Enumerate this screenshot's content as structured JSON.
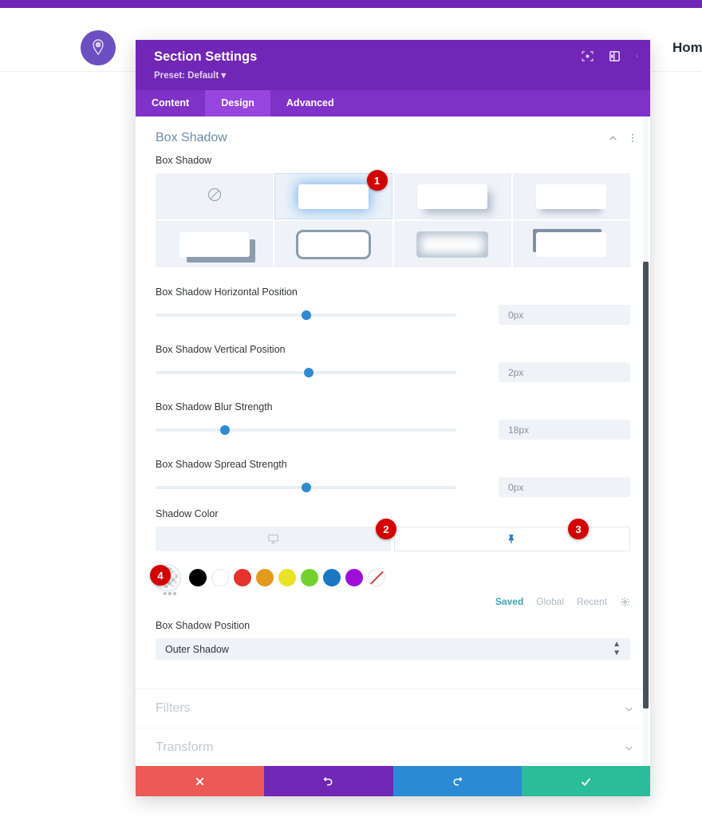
{
  "site": {
    "logo_icon": "map-pin-icon",
    "nav_home": "Home",
    "brand_color": "#7027b5"
  },
  "modal": {
    "title": "Section Settings",
    "preset_label": "Preset: Default",
    "header_icons": [
      "focus-icon",
      "layout-panel-icon",
      "more-vertical-icon"
    ],
    "tabs": [
      {
        "label": "Content",
        "active": false
      },
      {
        "label": "Design",
        "active": true
      },
      {
        "label": "Advanced",
        "active": false
      }
    ],
    "section": {
      "title": "Box Shadow",
      "caret_icon": "chevron-up-icon",
      "menu_icon": "more-vertical-icon"
    },
    "box_shadow": {
      "label": "Box Shadow",
      "presets": [
        {
          "name": "none",
          "style": "p-none",
          "selected": false,
          "badge": null
        },
        {
          "name": "glow",
          "style": "p1",
          "selected": true,
          "badge": "1"
        },
        {
          "name": "diagonal-soft",
          "style": "p2",
          "selected": false,
          "badge": null
        },
        {
          "name": "bottom-soft",
          "style": "p3",
          "selected": false,
          "badge": null
        },
        {
          "name": "hard-diagonal",
          "style": "p4",
          "selected": false,
          "badge": null
        },
        {
          "name": "outline-thick",
          "style": "p5",
          "selected": false,
          "badge": null
        },
        {
          "name": "inner-glow",
          "style": "p6",
          "selected": false,
          "badge": null
        },
        {
          "name": "top-left-hard",
          "style": "p7",
          "selected": false,
          "badge": null
        }
      ]
    },
    "sliders": [
      {
        "label": "Box Shadow Horizontal Position",
        "value": "0px",
        "percent": 50
      },
      {
        "label": "Box Shadow Vertical Position",
        "value": "2px",
        "percent": 51
      },
      {
        "label": "Box Shadow Blur Strength",
        "value": "18px",
        "percent": 23
      },
      {
        "label": "Box Shadow Spread Strength",
        "value": "0px",
        "percent": 50
      }
    ],
    "shadow_color": {
      "label": "Shadow Color",
      "tabs": [
        {
          "name": "desktop-responsive-tab",
          "icon": "monitor-icon",
          "active": true,
          "badge": "2"
        },
        {
          "name": "pin-hover-tab",
          "icon": "pin-icon",
          "active": false,
          "badge": "3"
        }
      ],
      "selected_swatch": {
        "name": "transparent",
        "badge": "4"
      },
      "swatches": [
        {
          "name": "black",
          "hex": "#000000"
        },
        {
          "name": "white",
          "hex": "#ffffff"
        },
        {
          "name": "red",
          "hex": "#e3332c"
        },
        {
          "name": "orange",
          "hex": "#e39a1c"
        },
        {
          "name": "yellow",
          "hex": "#eae224"
        },
        {
          "name": "green",
          "hex": "#73d12f"
        },
        {
          "name": "blue",
          "hex": "#1a77c4"
        },
        {
          "name": "purple",
          "hex": "#9e0fd8"
        },
        {
          "name": "none",
          "hex": "transparent"
        }
      ],
      "more_dots": "•••",
      "palette_tabs": [
        {
          "label": "Saved",
          "active": true
        },
        {
          "label": "Global",
          "active": false
        },
        {
          "label": "Recent",
          "active": false
        }
      ],
      "gear_icon": "gear-icon"
    },
    "position_field": {
      "label": "Box Shadow Position",
      "value": "Outer Shadow"
    },
    "collapsed_sections": [
      {
        "label": "Filters",
        "icon": "chevron-down-icon"
      },
      {
        "label": "Transform",
        "icon": "chevron-down-icon"
      }
    ],
    "footer_buttons": [
      {
        "name": "cancel-button",
        "icon": "close-icon",
        "color": "#eb5a56"
      },
      {
        "name": "undo-button",
        "icon": "undo-icon",
        "color": "#7027b5"
      },
      {
        "name": "redo-button",
        "icon": "redo-icon",
        "color": "#2a8ad4"
      },
      {
        "name": "save-button",
        "icon": "check-icon",
        "color": "#2bbd9a"
      }
    ]
  }
}
